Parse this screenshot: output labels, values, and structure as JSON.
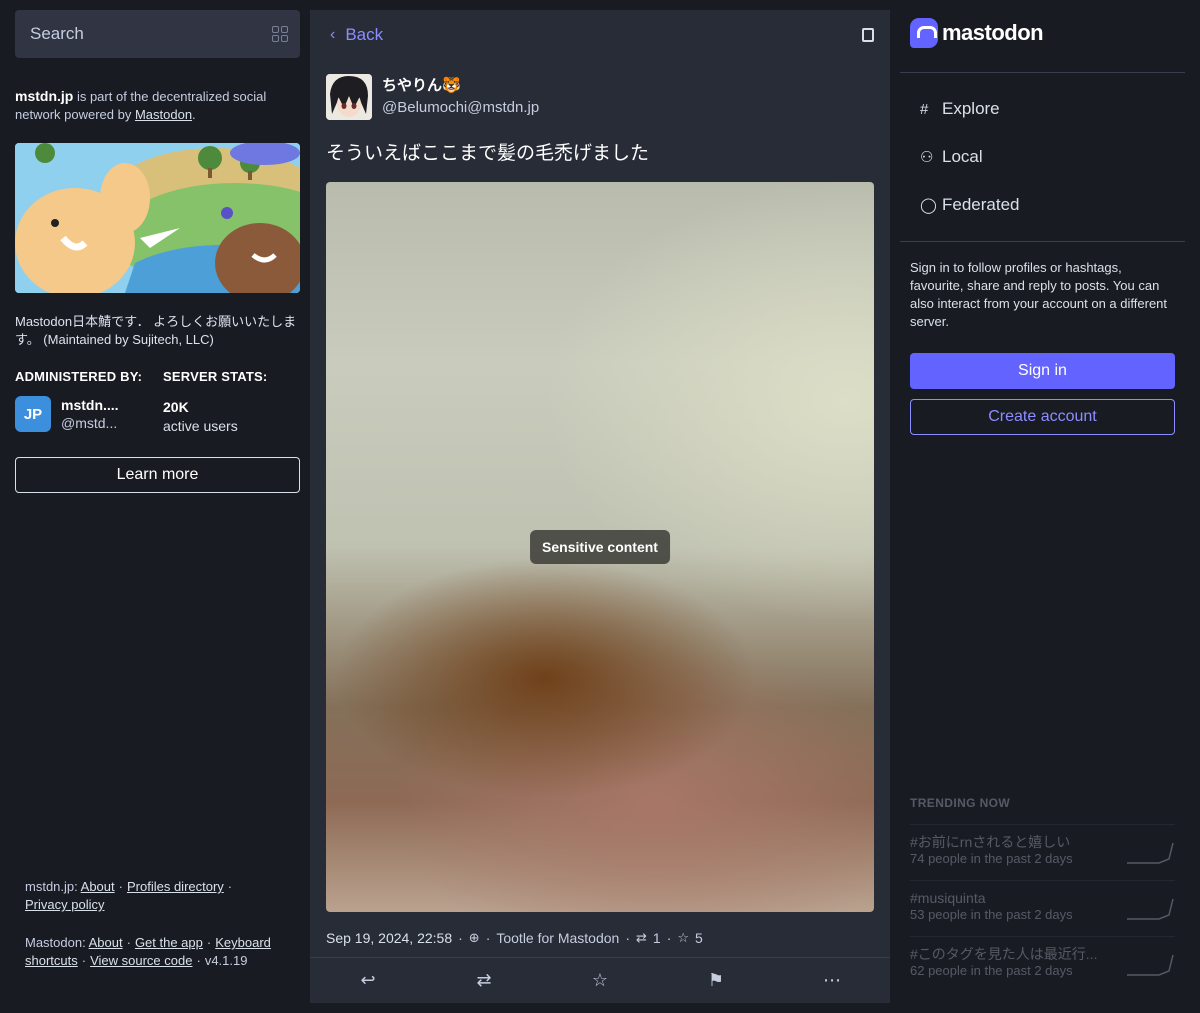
{
  "search": {
    "placeholder": "Search"
  },
  "server": {
    "domain": "mstdn.jp",
    "intro_text": " is part of the decentralized social network powered by ",
    "powered_by_link": "Mastodon",
    "intro_end": ".",
    "description": "Mastodon日本鯖です． よろしくお願いいたします。 (Maintained by Sujitech, LLC)",
    "admin_heading": "ADMINISTERED BY:",
    "stats_heading": "SERVER STATS:",
    "admin_avatar_text": "JP",
    "admin_name": "mstdn....",
    "admin_handle": "@mstd...",
    "active_users_count": "20K",
    "active_users_label": "active users",
    "learn_more": "Learn more"
  },
  "footer": {
    "server_label": "mstdn.jp",
    "server_links": [
      "About",
      "Profiles directory",
      "Privacy policy"
    ],
    "mastodon_label": "Mastodon",
    "mastodon_links": [
      "About",
      "Get the app",
      "Keyboard shortcuts",
      "View source code"
    ],
    "version": "v4.1.19"
  },
  "center": {
    "back_label": "Back",
    "status": {
      "display_name": "ちやりん🐯",
      "acct": "@Belumochi@mstdn.jp",
      "text": "そういえばここまで髪の毛禿げました",
      "sensitive_label": "Sensitive content",
      "timestamp": "Sep 19, 2024, 22:58",
      "application": "Tootle for Mastodon",
      "reblogs": "1",
      "favourites": "5"
    }
  },
  "right": {
    "logo_text": "mastodon",
    "nav": [
      {
        "label": "Explore",
        "icon": "hashtag-icon"
      },
      {
        "label": "Local",
        "icon": "users-icon"
      },
      {
        "label": "Federated",
        "icon": "globe-icon"
      }
    ],
    "signin_prompt": "Sign in to follow profiles or hashtags, favourite, share and reply to posts. You can also interact from your account on a different server.",
    "sign_in": "Sign in",
    "create_account": "Create account",
    "trending_heading": "TRENDING NOW",
    "trends": [
      {
        "name": "#お前にrnされると嬉しい",
        "count": "74 people in the past 2 days"
      },
      {
        "name": "#musiquinta",
        "count": "53 people in the past 2 days"
      },
      {
        "name": "#このタグを見た人は最近行...",
        "count": "62 people in the past 2 days"
      }
    ]
  },
  "colors": {
    "accent": "#6364ff",
    "link_accent": "#8c8dff",
    "background": "#191b22",
    "panel": "#282c37"
  }
}
